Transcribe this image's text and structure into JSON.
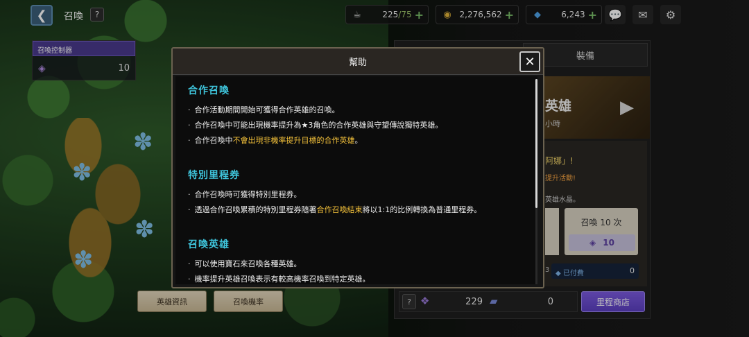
{
  "header": {
    "title": "召喚",
    "help": "?"
  },
  "resources": {
    "stamina_value": "225",
    "stamina_max": "/75",
    "gold": "2,276,562",
    "gems": "6,243",
    "plus": "+"
  },
  "controller": {
    "title": "召喚控制器",
    "count": "10"
  },
  "left_buttons": {
    "hero_info": "英雄資訊",
    "summon_rate": "召喚機率"
  },
  "right_panel": {
    "tab_equip": "裝備",
    "banner_title": "英雄",
    "banner_sub": "小時",
    "promo_line1": "阿娜」!",
    "promo_line2": "提升活動!",
    "promo_line3": "英雄水晶。",
    "summon10_label": "召喚 10 次",
    "summon10_cost": "10",
    "paid_left": "3",
    "paid_label": "已付費",
    "paid_value": "0"
  },
  "bottom": {
    "help": "?",
    "ticket1_value": "229",
    "ticket2_value": "0",
    "milestone_shop": "里程商店"
  },
  "dialog": {
    "title": "幫助",
    "close": "✕",
    "sections": [
      {
        "title": "合作召喚",
        "bullets": [
          {
            "text": "合作活動期間開始可獲得合作英雄的召喚。",
            "highlight": ""
          },
          {
            "text": "合作召喚中可能出現機率提升為★3角色的合作英雄與守望傳說獨特英雄。",
            "highlight": ""
          },
          {
            "pre": "合作召喚中",
            "highlight": "不會出現非機率提升目標的合作英雄",
            "post": "。"
          }
        ]
      },
      {
        "title": "特別里程券",
        "bullets": [
          {
            "text": "合作召喚時可獲得特別里程券。",
            "highlight": ""
          },
          {
            "pre": "透過合作召喚累積的特別里程券隨著",
            "highlight": "合作召喚結束",
            "post": "將以1:1的比例轉換為普通里程券。"
          }
        ]
      },
      {
        "title": "召喚英雄",
        "bullets": [
          {
            "text": "可以使用寶石來召喚各種英雄。",
            "highlight": ""
          },
          {
            "text": "機率提升英雄召喚表示有較高機率召喚到特定英雄。",
            "highlight": ""
          }
        ]
      }
    ]
  },
  "colors": {
    "section_title": "#3fc5dc",
    "highlight": "#f3c13a",
    "milestone_button": "#6b4fd0"
  },
  "icons": {
    "back": "chevron-left-icon",
    "stamina": "coffee-icon",
    "gold": "coin-icon",
    "gem": "gem-icon",
    "chat": "chat-icon",
    "mail": "mail-icon",
    "settings": "gear-icon"
  }
}
